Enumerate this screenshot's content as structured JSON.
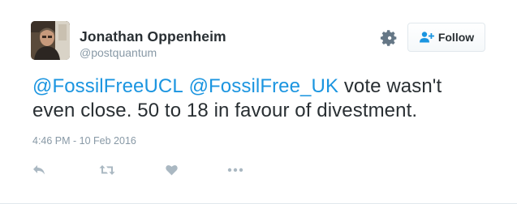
{
  "author": {
    "display_name": "Jonathan Oppenheim",
    "screen_name": "@postquantum",
    "avatar_icon": "user-avatar-photo"
  },
  "header": {
    "settings_icon": "gear-icon",
    "follow_icon": "follow-plus-icon",
    "follow_label": "Follow"
  },
  "tweet": {
    "mention_1": "@FossilFreeUCL",
    "mention_2": "@FossilFree_UK",
    "text_line_1_rest": " vote wasn't",
    "text_line_2": "even close. 50 to 18 in favour of divestment.",
    "timestamp": "4:46 PM - 10 Feb 2016"
  },
  "actions": [
    {
      "name": "reply",
      "icon": "reply-icon"
    },
    {
      "name": "retweet",
      "icon": "retweet-icon"
    },
    {
      "name": "like",
      "icon": "heart-icon"
    },
    {
      "name": "more",
      "icon": "more-dots-icon"
    }
  ],
  "colors": {
    "link": "#1b95e0",
    "muted": "#8899a6",
    "text": "#292f33",
    "border": "#e1e8ed",
    "follow_icon": "#1b95e0",
    "action_icon": "#aab8c2"
  }
}
